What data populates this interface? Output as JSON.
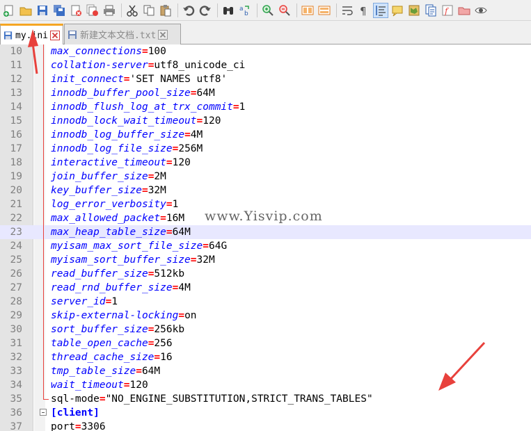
{
  "toolbar": {
    "buttons": [
      "new-file",
      "open-file",
      "save",
      "save-all",
      "close",
      "close-all",
      "print",
      "cut",
      "copy",
      "paste",
      "undo",
      "redo",
      "find",
      "replace",
      "zoom-in",
      "zoom-out",
      "sync-vertical",
      "sync-horizontal",
      "word-wrap",
      "show-all-chars",
      "indent-guide",
      "user-defined-language",
      "doc-map",
      "function-list",
      "folder-as-workspace",
      "monitoring",
      "macro-record"
    ]
  },
  "tabs": [
    {
      "label": "my.ini",
      "active": true
    },
    {
      "label": "新建文本文档.txt",
      "active": false
    }
  ],
  "editor": {
    "lines": [
      {
        "n": "10",
        "key": "max_connections",
        "val": "100"
      },
      {
        "n": "11",
        "key": "collation-server",
        "val": "utf8_unicode_ci"
      },
      {
        "n": "12",
        "key": "init_connect",
        "val": "'SET NAMES utf8'"
      },
      {
        "n": "13",
        "key": "innodb_buffer_pool_size",
        "val": "64M"
      },
      {
        "n": "14",
        "key": "innodb_flush_log_at_trx_commit",
        "val": "1"
      },
      {
        "n": "15",
        "key": "innodb_lock_wait_timeout",
        "val": "120"
      },
      {
        "n": "16",
        "key": "innodb_log_buffer_size",
        "val": "4M"
      },
      {
        "n": "17",
        "key": "innodb_log_file_size",
        "val": "256M"
      },
      {
        "n": "18",
        "key": "interactive_timeout",
        "val": "120"
      },
      {
        "n": "19",
        "key": "join_buffer_size",
        "val": "2M"
      },
      {
        "n": "20",
        "key": "key_buffer_size",
        "val": "32M"
      },
      {
        "n": "21",
        "key": "log_error_verbosity",
        "val": "1"
      },
      {
        "n": "22",
        "key": "max_allowed_packet",
        "val": "16M"
      },
      {
        "n": "23",
        "key": "max_heap_table_size",
        "val": "64M",
        "current": true
      },
      {
        "n": "24",
        "key": "myisam_max_sort_file_size",
        "val": "64G"
      },
      {
        "n": "25",
        "key": "myisam_sort_buffer_size",
        "val": "32M"
      },
      {
        "n": "26",
        "key": "read_buffer_size",
        "val": "512kb"
      },
      {
        "n": "27",
        "key": "read_rnd_buffer_size",
        "val": "4M"
      },
      {
        "n": "28",
        "key": "server_id",
        "val": "1"
      },
      {
        "n": "29",
        "key": "skip-external-locking",
        "val": "on"
      },
      {
        "n": "30",
        "key": "sort_buffer_size",
        "val": "256kb"
      },
      {
        "n": "31",
        "key": "table_open_cache",
        "val": "256"
      },
      {
        "n": "32",
        "key": "thread_cache_size",
        "val": "16"
      },
      {
        "n": "33",
        "key": "tmp_table_size",
        "val": "64M"
      },
      {
        "n": "34",
        "key": "wait_timeout",
        "val": "120"
      },
      {
        "n": "35",
        "key": "sql-mode",
        "val": "\"NO_ENGINE_SUBSTITUTION,STRICT_TRANS_TABLES\"",
        "plain_key": true
      },
      {
        "n": "36",
        "section": "[client]"
      },
      {
        "n": "37",
        "key": "port",
        "val": "3306",
        "plain_key": true
      }
    ]
  },
  "watermark": "www.Yisvip.com",
  "colors": {
    "keyword": "#0000ff",
    "operator": "#ff0000",
    "annotation": "#e8413c"
  }
}
